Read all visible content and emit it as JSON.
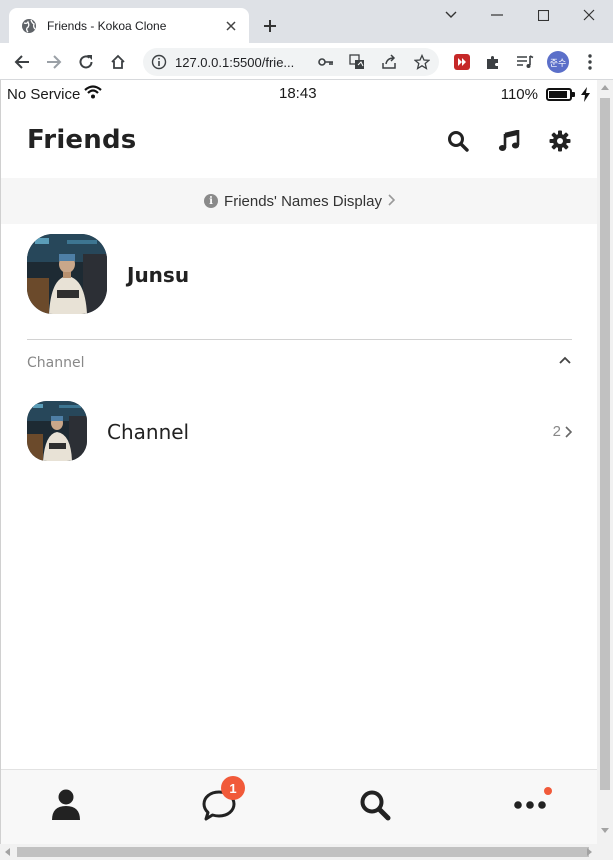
{
  "browser": {
    "tab_title": "Friends - Kokoa Clone",
    "url": "127.0.0.1:5500/frie...",
    "profile_label": "준수"
  },
  "status_bar": {
    "carrier": "No Service",
    "time": "18:43",
    "battery": "110%"
  },
  "header": {
    "title": "Friends",
    "icons": [
      "search-icon",
      "music-icon",
      "gear-icon"
    ]
  },
  "banner": {
    "label": "Friends' Names Display"
  },
  "profile": {
    "name": "Junsu"
  },
  "section": {
    "label": "Channel"
  },
  "channel": {
    "name": "Channel",
    "count": "2"
  },
  "nav": {
    "chat_badge": "1",
    "items": [
      "user-icon",
      "chat-icon",
      "search-icon",
      "more-icon"
    ]
  },
  "colors": {
    "accent": "#f15a3a",
    "text": "#222222",
    "muted": "#888888"
  }
}
